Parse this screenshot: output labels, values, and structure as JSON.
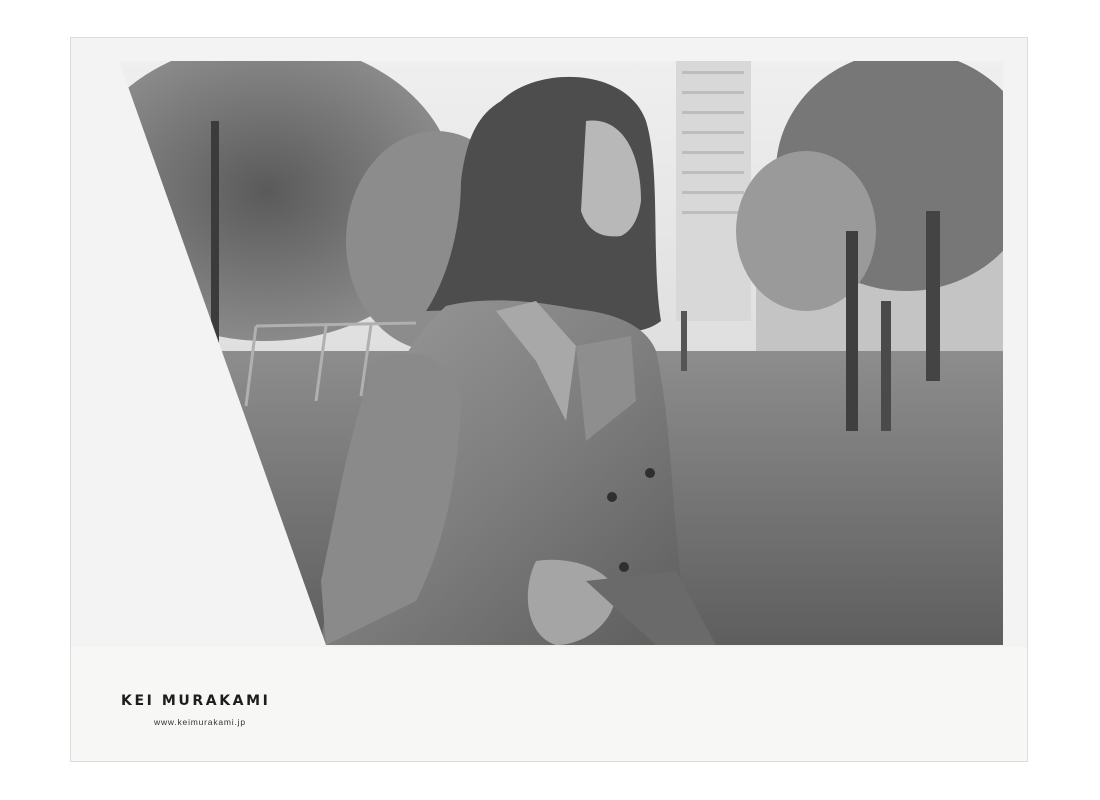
{
  "brand": {
    "name": "KEI MURAKAMI",
    "url": "www.keimurakami.jp"
  },
  "colors": {
    "panel": "#f3f3f3",
    "footer": "#f7f7f6",
    "text": "#1d1d1d"
  },
  "image": {
    "style": "black-and-white photograph",
    "subject": "woman in trench coat walking in a park"
  }
}
